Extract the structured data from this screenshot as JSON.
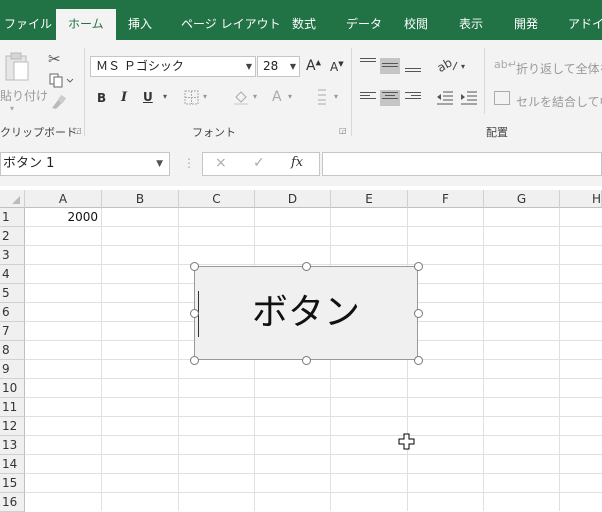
{
  "ribbon": {
    "tabs": [
      {
        "label": "ファイル",
        "active": false
      },
      {
        "label": "ホーム",
        "active": true
      },
      {
        "label": "挿入",
        "active": false
      },
      {
        "label": "ページ レイアウト",
        "active": false
      },
      {
        "label": "数式",
        "active": false
      },
      {
        "label": "データ",
        "active": false
      },
      {
        "label": "校閲",
        "active": false
      },
      {
        "label": "表示",
        "active": false
      },
      {
        "label": "開発",
        "active": false
      },
      {
        "label": "アドイン",
        "active": false
      }
    ],
    "clipboard": {
      "paste_label": "貼り付け",
      "group_label": "クリップボード"
    },
    "font": {
      "font_name": "ＭＳ Ｐゴシック",
      "font_size": "28",
      "group_label": "フォント",
      "bold": "B",
      "italic": "I",
      "underline": "U",
      "grow": "A",
      "shrink": "A",
      "color_a": "A"
    },
    "alignment": {
      "wrap_text": "折り返して全体を",
      "merge_center": "セルを結合して中",
      "group_label": "配置"
    }
  },
  "formula_bar": {
    "name_box": "ボタン 1",
    "fx": "fx",
    "cancel": "×",
    "enter": "✓"
  },
  "sheet": {
    "columns": [
      "A",
      "B",
      "C",
      "D",
      "E",
      "F",
      "G",
      "H"
    ],
    "rows": [
      "1",
      "2",
      "3",
      "4",
      "5",
      "6",
      "7",
      "8",
      "9",
      "10",
      "11",
      "12",
      "13",
      "14",
      "15",
      "16"
    ],
    "cells": {
      "A1": "2000"
    }
  },
  "button_shape": {
    "label": "ボタン"
  },
  "colors": {
    "excel_green": "#217346",
    "ribbon_bg": "#f3f3f3"
  }
}
